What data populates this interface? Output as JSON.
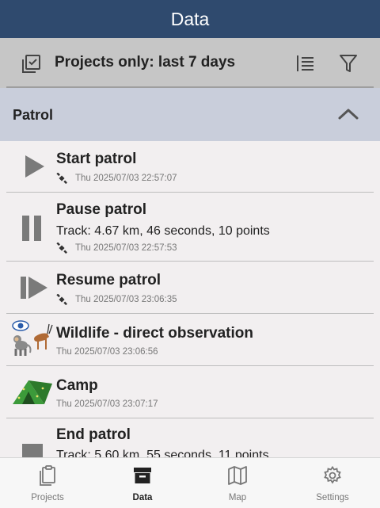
{
  "app_bar": {
    "title": "Data"
  },
  "filter_bar": {
    "label": "Projects only: last 7 days"
  },
  "section": {
    "title": "Patrol"
  },
  "observations": [
    {
      "title": "Start patrol",
      "timestamp": "Thu 2025/07/03 22:57:07",
      "icon": "play-icon"
    },
    {
      "title": "Pause patrol",
      "detail": "Track: 4.67 km, 46 seconds, 10 points",
      "timestamp": "Thu 2025/07/03 22:57:53",
      "icon": "pause-icon"
    },
    {
      "title": "Resume patrol",
      "timestamp": "Thu 2025/07/03 23:06:35",
      "icon": "resume-icon"
    },
    {
      "title": "Wildlife - direct observation",
      "timestamp": "Thu 2025/07/03 23:06:56",
      "icon": "wildlife-icon"
    },
    {
      "title": "Camp",
      "timestamp": "Thu 2025/07/03 23:07:17",
      "icon": "tent-icon"
    },
    {
      "title": "End patrol",
      "detail": "Track: 5.60 km, 55 seconds, 11 points",
      "icon": "stop-icon"
    }
  ],
  "bottom_nav": {
    "projects": "Projects",
    "data": "Data",
    "map": "Map",
    "settings": "Settings",
    "active": "data"
  },
  "colors": {
    "header": "#2f4a6e",
    "filter_bar": "#c6c6c6",
    "section": "#c9cedb",
    "icon_gray": "#7a7a7a"
  }
}
